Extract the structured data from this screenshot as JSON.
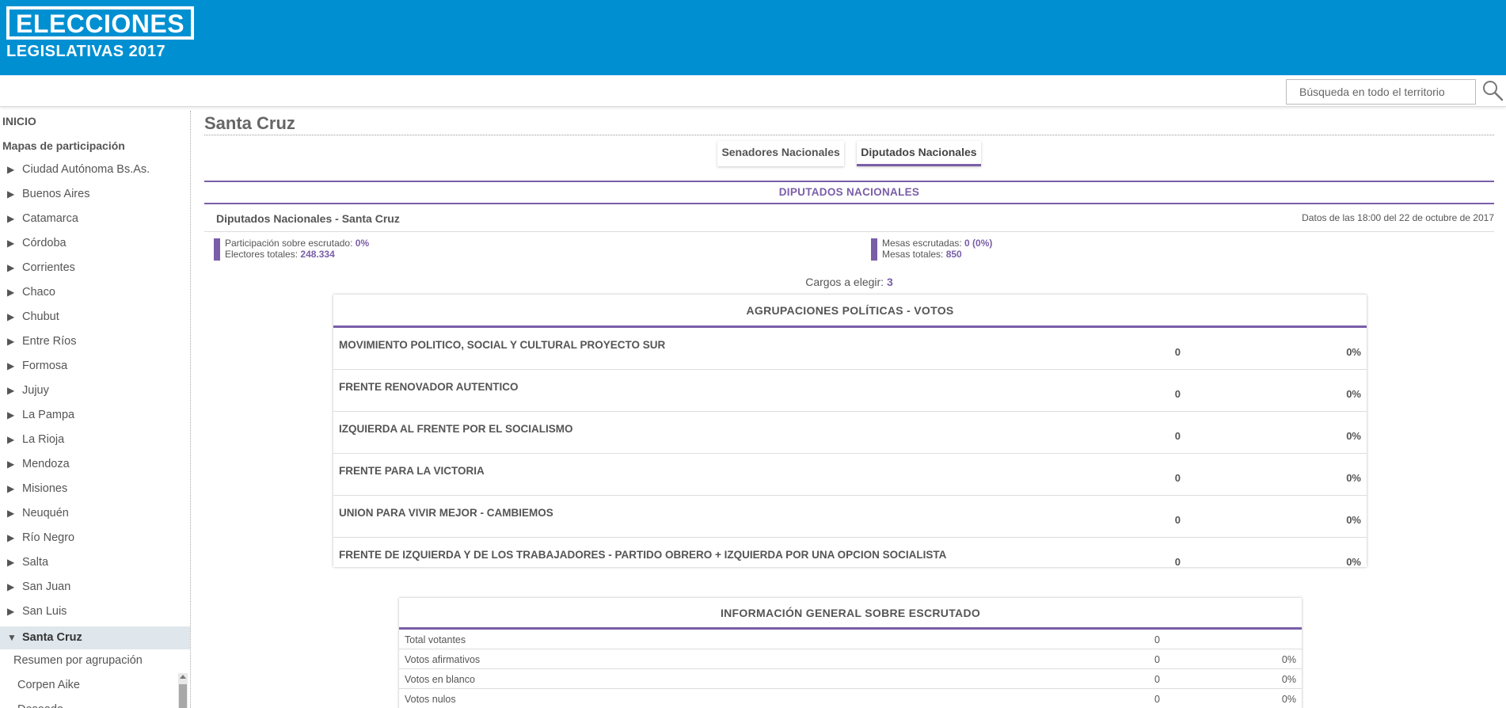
{
  "header": {
    "logo_line1": "ELECCIONES",
    "logo_line2": "LEGISLATIVAS 2017",
    "bg_color": "#0090d2"
  },
  "search": {
    "placeholder": "Búsqueda en todo el territorio",
    "icon": "search-icon"
  },
  "sidebar": {
    "top_links": [
      "INICIO",
      "Mapas de participación"
    ],
    "provinces": [
      "Ciudad Autónoma Bs.As.",
      "Buenos Aires",
      "Catamarca",
      "Córdoba",
      "Corrientes",
      "Chaco",
      "Chubut",
      "Entre Ríos",
      "Formosa",
      "Jujuy",
      "La Pampa",
      "La Rioja",
      "Mendoza",
      "Misiones",
      "Neuquén",
      "Río Negro",
      "Salta",
      "San Juan",
      "San Luis"
    ],
    "active_province": "Santa Cruz",
    "sub_items": [
      "Resumen por agrupación",
      "Corpen Aike",
      "Deseado"
    ]
  },
  "main": {
    "title": "Santa Cruz",
    "tabs": [
      {
        "label": "Senadores Nacionales",
        "active": false
      },
      {
        "label": "Diputados Nacionales",
        "active": true
      }
    ],
    "section_title": "DIPUTADOS NACIONALES",
    "subheader": "Diputados Nacionales - Santa Cruz",
    "timestamp": "Datos de las 18:00 del 22 de octubre de 2017",
    "stats": {
      "participacion_label": "Participación sobre escrutado: ",
      "participacion_value": "0%",
      "electores_label": "Electores totales: ",
      "electores_value": "248.334",
      "mesas_esc_label": "Mesas escrutadas: ",
      "mesas_esc_value": "0 (0%)",
      "mesas_tot_label": "Mesas totales: ",
      "mesas_tot_value": "850"
    },
    "cargos_label": "Cargos a elegir: ",
    "cargos_value": "3",
    "accent_color": "#7a5ea8"
  },
  "parties_table": {
    "title": "AGRUPACIONES POLÍTICAS - VOTOS",
    "rows": [
      {
        "name": "MOVIMIENTO POLITICO, SOCIAL Y CULTURAL PROYECTO SUR",
        "votes": "0",
        "pct": "0%"
      },
      {
        "name": "FRENTE RENOVADOR AUTENTICO",
        "votes": "0",
        "pct": "0%"
      },
      {
        "name": "IZQUIERDA AL FRENTE POR EL SOCIALISMO",
        "votes": "0",
        "pct": "0%"
      },
      {
        "name": "FRENTE PARA LA VICTORIA",
        "votes": "0",
        "pct": "0%"
      },
      {
        "name": "UNION PARA VIVIR MEJOR - CAMBIEMOS",
        "votes": "0",
        "pct": "0%"
      },
      {
        "name": "FRENTE DE IZQUIERDA Y DE LOS TRABAJADORES - PARTIDO OBRERO + IZQUIERDA POR UNA OPCION SOCIALISTA",
        "votes": "0",
        "pct": "0%"
      }
    ]
  },
  "general_table": {
    "title": "INFORMACIÓN GENERAL SOBRE ESCRUTADO",
    "rows": [
      {
        "label": "Total votantes",
        "value": "0",
        "pct": ""
      },
      {
        "label": "Votos afirmativos",
        "value": "0",
        "pct": "0%"
      },
      {
        "label": "Votos en blanco",
        "value": "0",
        "pct": "0%"
      },
      {
        "label": "Votos nulos",
        "value": "0",
        "pct": "0%"
      }
    ]
  }
}
